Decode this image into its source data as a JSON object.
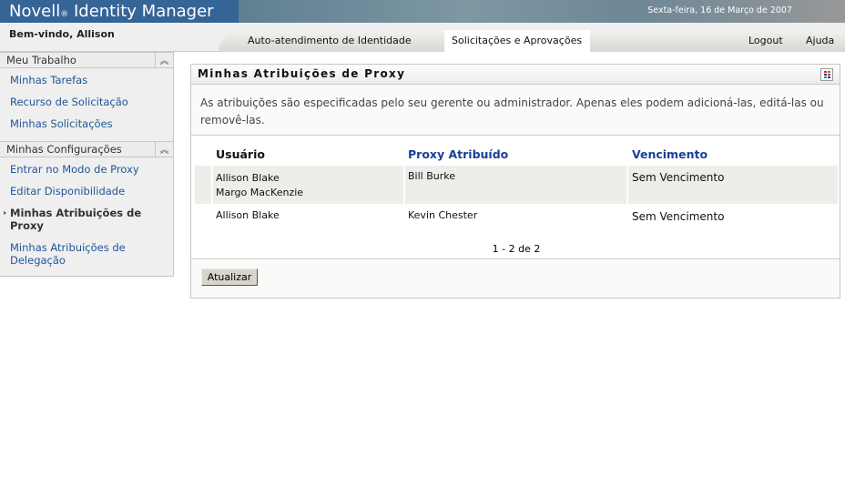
{
  "header": {
    "brand": "Novell",
    "reg": "®",
    "product": "Identity Manager",
    "date": "Sexta-feira, 16 de Março de 2007"
  },
  "nav": {
    "welcome": "Bem-vindo, Allison",
    "tabs": [
      "Auto-atendimento de Identidade",
      "Solicitações e Aprovações"
    ],
    "logout": "Logout",
    "help": "Ajuda"
  },
  "sidebar": {
    "sections": [
      {
        "title": "Meu Trabalho",
        "items": [
          "Minhas Tarefas",
          "Recurso de Solicitação",
          "Minhas Solicitações"
        ]
      },
      {
        "title": "Minhas Configurações",
        "items": [
          "Entrar no Modo de Proxy",
          "Editar Disponibilidade",
          "Minhas Atribuições de Proxy",
          "Minhas Atribuições de Delegação"
        ]
      }
    ]
  },
  "panel": {
    "title": "Minhas Atribuições de Proxy",
    "description": "As atribuições são especificadas pelo seu gerente ou administrador. Apenas eles podem adicioná-las, editá-las ou removê-las.",
    "columns": [
      "Usuário",
      "Proxy Atribuído",
      "Vencimento"
    ],
    "rows": [
      {
        "users": [
          "Allison Blake",
          "Margo MacKenzie"
        ],
        "proxy": "Bill Burke",
        "expiry": "Sem Vencimento"
      },
      {
        "users": [
          "Allison Blake"
        ],
        "proxy": "Kevin Chester",
        "expiry": "Sem Vencimento"
      }
    ],
    "pager": "1 - 2 de 2",
    "refresh": "Atualizar"
  },
  "colors": {
    "link": "#1f5597",
    "header": "#356497",
    "heading_link": "#1a3f9a"
  }
}
